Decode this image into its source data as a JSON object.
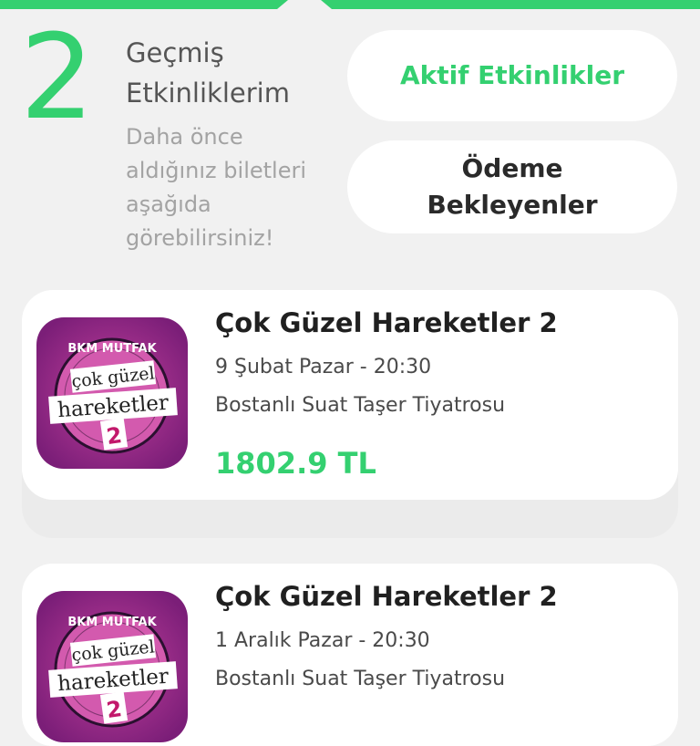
{
  "header": {
    "count": "2",
    "title_line1": "Geçmiş",
    "title_line2": "Etkinliklerim",
    "desc_line1": "Daha önce",
    "desc_line2": "aldığınız biletleri",
    "desc_line3": "aşağıda",
    "desc_line4": "görebilirsiniz!"
  },
  "buttons": {
    "active_label": "Aktif Etkinlikler",
    "pending_label": "Ödeme Bekleyenler"
  },
  "events": [
    {
      "title": "Çok Güzel Hareketler 2",
      "date": "9 Şubat Pazar - 20:30",
      "venue": "Bostanlı Suat Taşer Tiyatrosu",
      "price": "1802.9 TL",
      "poster": {
        "brand": "BKM MUTFAK",
        "line1": "çok güzel",
        "line2": "hareketler",
        "number": "2"
      }
    },
    {
      "title": "Çok Güzel Hareketler 2",
      "date": "1 Aralık Pazar - 20:30",
      "venue": "Bostanlı Suat Taşer Tiyatrosu",
      "poster": {
        "brand": "BKM MUTFAK",
        "line1": "çok güzel",
        "line2": "hareketler",
        "number": "2"
      }
    }
  ],
  "colors": {
    "accent": "#34d070",
    "background": "#f1f1f1",
    "card": "#ffffff",
    "poster_bg": "#8a1f8a"
  }
}
